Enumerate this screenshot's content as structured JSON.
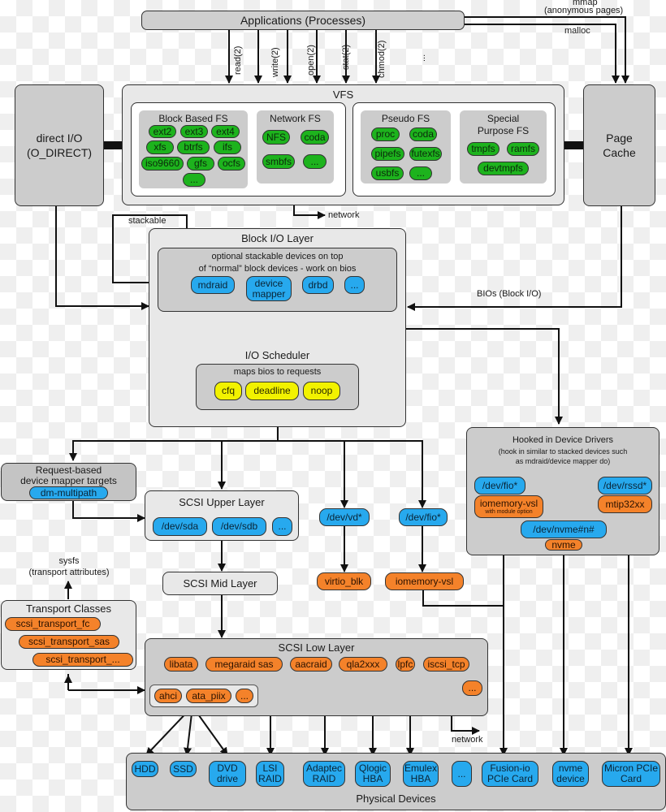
{
  "applications": {
    "title": "Applications (Processes)"
  },
  "syscalls": [
    "read(2)",
    "write(2)",
    "open(2)",
    "stat(2)",
    "chmod(2)",
    "..."
  ],
  "memory_paths": {
    "mmap": "mmap",
    "mmap_note": "(anonymous pages)",
    "malloc": "malloc"
  },
  "direct_io": {
    "line1": "direct I/O",
    "line2": "(O_DIRECT)"
  },
  "page_cache": {
    "line1": "Page",
    "line2": "Cache"
  },
  "vfs": {
    "title": "VFS",
    "block_fs": {
      "title": "Block Based FS",
      "items": [
        "ext2",
        "ext3",
        "ext4",
        "xfs",
        "btrfs",
        "ifs",
        "iso9660",
        "gfs",
        "ocfs",
        "..."
      ]
    },
    "network_fs": {
      "title": "Network FS",
      "items": [
        "NFS",
        "coda",
        "smbfs",
        "..."
      ]
    },
    "pseudo_fs": {
      "title": "Pseudo FS",
      "items": [
        "proc",
        "coda",
        "pipefs",
        "futexfs",
        "usbfs",
        "..."
      ]
    },
    "special_fs": {
      "title_line1": "Special",
      "title_line2": "Purpose FS",
      "items": [
        "tmpfs",
        "ramfs",
        "devtmpfs"
      ]
    },
    "network_label": "network"
  },
  "stackable_label": "stackable",
  "bios_label": "BIOs (Block I/O)",
  "block_io": {
    "title": "Block I/O Layer",
    "stack_desc_line1": "optional stackable devices on top",
    "stack_desc_line2": "of “normal” block devices - work on bios",
    "stack_items": [
      "mdraid",
      "device mapper",
      "drbd",
      "..."
    ],
    "scheduler_title": "I/O Scheduler",
    "scheduler_desc": "maps bios to requests",
    "schedulers": [
      "cfq",
      "deadline",
      "noop"
    ]
  },
  "hooked_drivers": {
    "title": "Hooked in Device Drivers",
    "desc_line1": "(hook in similar to stacked devices such",
    "desc_line2": "as mdraid/device mapper do)",
    "dev_fio": "/dev/fio*",
    "iomemory": "iomemory-vsl",
    "iomemory_note": "with module option",
    "dev_rssd": "/dev/rssd*",
    "mtip": "mtip32xx",
    "dev_nvme": "/dev/nvme#n#",
    "nvme": "nvme"
  },
  "request_dm": {
    "line1": "Request-based",
    "line2": "device mapper targets",
    "item": "dm-multipath"
  },
  "scsi_upper": {
    "title": "SCSI Upper Layer",
    "items": [
      "/dev/sda",
      "/dev/sdb",
      "..."
    ]
  },
  "virtio": {
    "dev": "/dev/vd*",
    "driver": "virtio_blk"
  },
  "fio": {
    "dev": "/dev/fio*",
    "driver": "iomemory-vsl"
  },
  "scsi_mid": {
    "title": "SCSI Mid Layer"
  },
  "sysfs": {
    "line1": "sysfs",
    "line2": "(transport attributes)"
  },
  "transport": {
    "title": "Transport Classes",
    "items": [
      "scsi_transport_fc",
      "scsi_transport_sas",
      "scsi_transport_..."
    ]
  },
  "scsi_low": {
    "title": "SCSI Low Layer",
    "drivers": [
      "libata",
      "megaraid sas",
      "aacraid",
      "qla2xxx",
      "lpfc",
      "iscsi_tcp",
      "..."
    ],
    "libata_items": [
      "ahci",
      "ata_piix",
      "..."
    ],
    "network_label": "network"
  },
  "physical": {
    "title": "Physical Devices",
    "devices": [
      "HDD",
      "SSD",
      "DVD drive",
      "LSI RAID",
      "Adaptec RAID",
      "Qlogic HBA",
      "Emulex HBA",
      "...",
      "Fusion-io PCIe Card",
      "nvme device",
      "Micron PCIe Card"
    ]
  },
  "colors": {
    "fs": "#1db31d",
    "device": "#27a9ee",
    "scheduler": "#f2f200",
    "driver": "#f4822a"
  }
}
